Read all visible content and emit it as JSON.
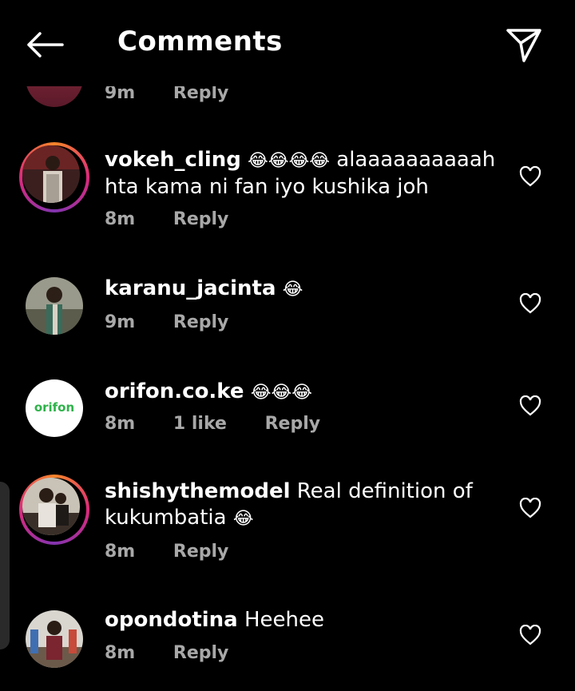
{
  "header": {
    "title": "Comments"
  },
  "top_partial": {
    "time": "9m",
    "reply": "Reply"
  },
  "comments": [
    {
      "username": "vokeh_cling",
      "emoji": "😂😂😂😂",
      "text_line1": "alaaaaaaaaaah",
      "text_line2": "hta kama ni fan iyo kushika joh",
      "time": "8m",
      "reply": "Reply"
    },
    {
      "username": "karanu_jacinta",
      "emoji": "😂",
      "time": "9m",
      "reply": "Reply"
    },
    {
      "username": "orifon.co.ke",
      "emoji": "😂😂😂",
      "time": "8m",
      "likes": "1 like",
      "reply": "Reply",
      "avatar_logo": "orifon"
    },
    {
      "username": "shishythemodel",
      "text_line1": "Real definition of",
      "text_line2": "kukumbatia",
      "emoji": "😂",
      "time": "8m",
      "reply": "Reply"
    },
    {
      "username": "opondotina",
      "text_line1": "Heehee",
      "time": "8m",
      "reply": "Reply"
    }
  ]
}
